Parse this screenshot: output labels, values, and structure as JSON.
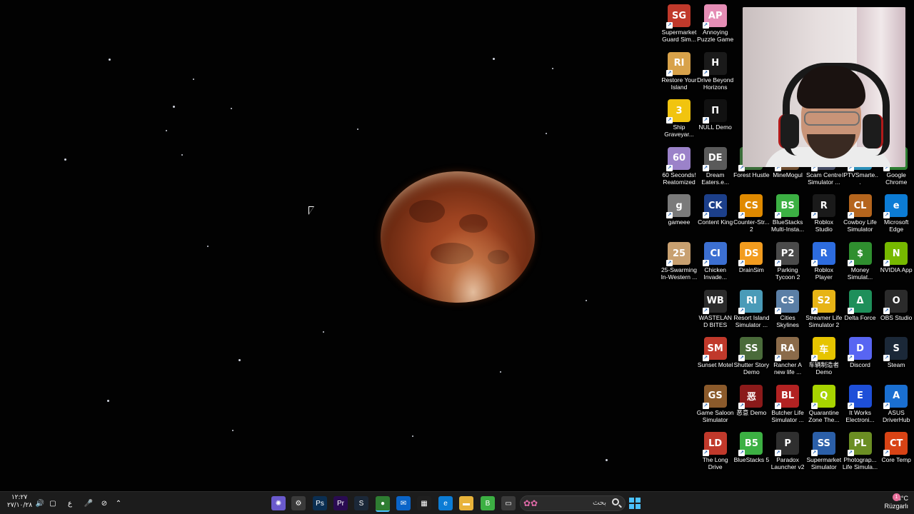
{
  "desktop_icons": [
    {
      "label": "Supermarket Guard Sim...",
      "color": "#c0392b",
      "glyph": "SG"
    },
    {
      "label": "Annoying Puzzle Game",
      "color": "#e58db5",
      "glyph": "AP"
    },
    {
      "label": "Restore Your Island",
      "color": "#d8a24a",
      "glyph": "RI"
    },
    {
      "label": "Drive Beyond Horizons",
      "color": "#1a1a1a",
      "glyph": "H"
    },
    {
      "label": "Ship Graveyar...",
      "color": "#f1c40f",
      "glyph": "3"
    },
    {
      "label": "NULL Demo",
      "color": "#111111",
      "glyph": "Π"
    },
    {
      "label": "60 Seconds! Reatomized",
      "color": "#9b82c9",
      "glyph": "60"
    },
    {
      "label": "Dream Eaters.e...",
      "color": "#5a5a5a",
      "glyph": "DE"
    },
    {
      "label": "Forest Hustle",
      "color": "#3b6e3a",
      "glyph": "FH"
    },
    {
      "label": "MineMogul",
      "color": "#6d4c2e",
      "glyph": "MM"
    },
    {
      "label": "Scam Centre Simulator ...",
      "color": "#444b63",
      "glyph": "SC"
    },
    {
      "label": "IPTVSmarte...",
      "color": "#2a8fb8",
      "glyph": "TV"
    },
    {
      "label": "Google Chrome",
      "color": "#2e7d32",
      "glyph": "G"
    },
    {
      "label": "gameee",
      "color": "#7a7a7a",
      "glyph": "g"
    },
    {
      "label": "Content King",
      "color": "#1c3f8a",
      "glyph": "CK"
    },
    {
      "label": "Counter-Str... 2",
      "color": "#e08a00",
      "glyph": "CS"
    },
    {
      "label": "BlueStacks Multi-Insta...",
      "color": "#3cb043",
      "glyph": "BS"
    },
    {
      "label": "Roblox Studio",
      "color": "#1a1a1a",
      "glyph": "R"
    },
    {
      "label": "Cowboy Life Simulator",
      "color": "#b5651d",
      "glyph": "CL"
    },
    {
      "label": "Microsoft Edge",
      "color": "#0c7cd5",
      "glyph": "e"
    },
    {
      "label": "25-Swarming In-Western ...",
      "color": "#c8a070",
      "glyph": "25"
    },
    {
      "label": "Chicken Invade...",
      "color": "#3c6fd1",
      "glyph": "CI"
    },
    {
      "label": "DrainSim",
      "color": "#f29c1f",
      "glyph": "DS"
    },
    {
      "label": "Parking Tycoon 2",
      "color": "#4a4a4a",
      "glyph": "P2"
    },
    {
      "label": "Roblox Player",
      "color": "#2d6cdf",
      "glyph": "R"
    },
    {
      "label": "Money Simulat...",
      "color": "#2f8f2f",
      "glyph": "$"
    },
    {
      "label": "NVIDIA App",
      "color": "#76b900",
      "glyph": "N"
    },
    {
      "label": "WASTELAND BITES",
      "color": "#2b2b2b",
      "glyph": "WB"
    },
    {
      "label": "Resort Island Simulator ...",
      "color": "#4a9bb8",
      "glyph": "RI"
    },
    {
      "label": "Cities Skylines",
      "color": "#5b7fa6",
      "glyph": "CS"
    },
    {
      "label": "Streamer Life Simulator 2",
      "color": "#e7b416",
      "glyph": "S2"
    },
    {
      "label": "Delta Force",
      "color": "#1e8f5a",
      "glyph": "Δ"
    },
    {
      "label": "OBS Studio",
      "color": "#2b2b2b",
      "glyph": "O"
    },
    {
      "label": "Sunset Motel",
      "color": "#c0392b",
      "glyph": "SM"
    },
    {
      "label": "Shutter Story Demo",
      "color": "#4a6b3a",
      "glyph": "SS"
    },
    {
      "label": "Rancher A new life ...",
      "color": "#8b6b4a",
      "glyph": "RA"
    },
    {
      "label": "车辆制造者 Demo",
      "color": "#e6c400",
      "glyph": "车"
    },
    {
      "label": "Discord",
      "color": "#5865f2",
      "glyph": "D"
    },
    {
      "label": "Steam",
      "color": "#1b2838",
      "glyph": "S"
    },
    {
      "label": "Game Saloon Simulator",
      "color": "#8b5a2b",
      "glyph": "GS"
    },
    {
      "label": "恶意 Demo",
      "color": "#8b1a1a",
      "glyph": "恶"
    },
    {
      "label": "Butcher Life Simulator ...",
      "color": "#b22222",
      "glyph": "BL"
    },
    {
      "label": "Quarantine Zone The...",
      "color": "#a8d400",
      "glyph": "Q"
    },
    {
      "label": "It Works Electroni...",
      "color": "#1e4fd8",
      "glyph": "E"
    },
    {
      "label": "ASUS DriverHub",
      "color": "#1a6fd1",
      "glyph": "A"
    },
    {
      "label": "The Long Drive",
      "color": "#c0392b",
      "glyph": "LD"
    },
    {
      "label": "BlueStacks 5",
      "color": "#3cb043",
      "glyph": "B5"
    },
    {
      "label": "Paradox Launcher v2",
      "color": "#2f2f2f",
      "glyph": "P"
    },
    {
      "label": "Supermarket Simulator",
      "color": "#2b5fa8",
      "glyph": "SS"
    },
    {
      "label": "Photograp... Life Simula...",
      "color": "#6b8e23",
      "glyph": "PL"
    },
    {
      "label": "Core Temp",
      "color": "#d84315",
      "glyph": "CT"
    }
  ],
  "taskbar": {
    "clock_time": "١٢:٢٧",
    "clock_date": "٢٧/١٠/٢٨",
    "lang": "ع",
    "search_placeholder": "بحث",
    "weather_temp": "13°C",
    "weather_desc": "Rüzgarlı",
    "notification_count": "1",
    "pinned_apps": [
      {
        "name": "ai-app",
        "color": "#6a5acd",
        "glyph": "✺"
      },
      {
        "name": "settings-app",
        "color": "#3a3a3a",
        "glyph": "⚙"
      },
      {
        "name": "photoshop",
        "color": "#0b2f52",
        "glyph": "Ps"
      },
      {
        "name": "premiere-pro",
        "color": "#2a0b52",
        "glyph": "Pr"
      },
      {
        "name": "steam",
        "color": "#1b2838",
        "glyph": "S"
      },
      {
        "name": "google-chrome",
        "color": "#2e7d32",
        "glyph": "●"
      },
      {
        "name": "mail",
        "color": "#0a64c8",
        "glyph": "✉"
      },
      {
        "name": "microsoft-store",
        "color": "#1f1f1f",
        "glyph": "▦"
      },
      {
        "name": "microsoft-edge",
        "color": "#0c7cd5",
        "glyph": "e"
      },
      {
        "name": "file-explorer",
        "color": "#e8b33a",
        "glyph": "▬"
      },
      {
        "name": "bluestacks",
        "color": "#3cb043",
        "glyph": "B"
      },
      {
        "name": "window-app",
        "color": "#3a3a3a",
        "glyph": "▭"
      }
    ]
  }
}
